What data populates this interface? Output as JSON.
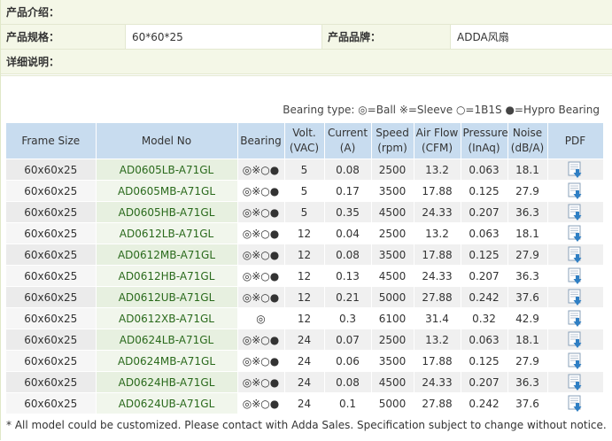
{
  "header": {
    "intro_label": "产品介绍：",
    "spec_label": "产品规格：",
    "spec_value": "60*60*25",
    "brand_label": "产品品牌：",
    "brand_value": "ADDA风扇",
    "detail_label": "详细说明："
  },
  "legend": {
    "prefix": "Bearing type:",
    "ball": "◎=Ball",
    "sleeve": "※=Sleeve",
    "b1s": "○=1B1S",
    "hypro": "●=Hypro Bearing"
  },
  "table": {
    "headers": [
      "Frame Size",
      "Model No",
      "Bearing",
      "Volt.\n(VAC)",
      "Current\n(A)",
      "Speed\n(rpm)",
      "Air Flow\n(CFM)",
      "Pressure\n(InAq)",
      "Noise\n(dB/A)",
      "PDF"
    ],
    "rows": [
      {
        "frame": "60x60x25",
        "model": "AD0605LB-A71GL",
        "bearing": "◎※○●",
        "volt": "5",
        "current": "0.08",
        "speed": "2500",
        "airflow": "13.2",
        "pressure": "0.063",
        "noise": "18.1"
      },
      {
        "frame": "60x60x25",
        "model": "AD0605MB-A71GL",
        "bearing": "◎※○●",
        "volt": "5",
        "current": "0.17",
        "speed": "3500",
        "airflow": "17.88",
        "pressure": "0.125",
        "noise": "27.9"
      },
      {
        "frame": "60x60x25",
        "model": "AD0605HB-A71GL",
        "bearing": "◎※○●",
        "volt": "5",
        "current": "0.35",
        "speed": "4500",
        "airflow": "24.33",
        "pressure": "0.207",
        "noise": "36.3"
      },
      {
        "frame": "60x60x25",
        "model": "AD0612LB-A71GL",
        "bearing": "◎※○●",
        "volt": "12",
        "current": "0.04",
        "speed": "2500",
        "airflow": "13.2",
        "pressure": "0.063",
        "noise": "18.1"
      },
      {
        "frame": "60x60x25",
        "model": "AD0612MB-A71GL",
        "bearing": "◎※○●",
        "volt": "12",
        "current": "0.08",
        "speed": "3500",
        "airflow": "17.88",
        "pressure": "0.125",
        "noise": "27.9"
      },
      {
        "frame": "60x60x25",
        "model": "AD0612HB-A71GL",
        "bearing": "◎※○●",
        "volt": "12",
        "current": "0.13",
        "speed": "4500",
        "airflow": "24.33",
        "pressure": "0.207",
        "noise": "36.3"
      },
      {
        "frame": "60x60x25",
        "model": "AD0612UB-A71GL",
        "bearing": "◎※○●",
        "volt": "12",
        "current": "0.21",
        "speed": "5000",
        "airflow": "27.88",
        "pressure": "0.242",
        "noise": "37.6"
      },
      {
        "frame": "60x60x25",
        "model": "AD0612XB-A71GL",
        "bearing": "◎",
        "volt": "12",
        "current": "0.3",
        "speed": "6100",
        "airflow": "31.4",
        "pressure": "0.32",
        "noise": "42.9"
      },
      {
        "frame": "60x60x25",
        "model": "AD0624LB-A71GL",
        "bearing": "◎※○●",
        "volt": "24",
        "current": "0.07",
        "speed": "2500",
        "airflow": "13.2",
        "pressure": "0.063",
        "noise": "18.1"
      },
      {
        "frame": "60x60x25",
        "model": "AD0624MB-A71GL",
        "bearing": "◎※○●",
        "volt": "24",
        "current": "0.06",
        "speed": "3500",
        "airflow": "17.88",
        "pressure": "0.125",
        "noise": "27.9"
      },
      {
        "frame": "60x60x25",
        "model": "AD0624HB-A71GL",
        "bearing": "◎※○●",
        "volt": "24",
        "current": "0.08",
        "speed": "4500",
        "airflow": "24.33",
        "pressure": "0.207",
        "noise": "36.3"
      },
      {
        "frame": "60x60x25",
        "model": "AD0624UB-A71GL",
        "bearing": "◎※○●",
        "volt": "24",
        "current": "0.1",
        "speed": "5000",
        "airflow": "27.88",
        "pressure": "0.242",
        "noise": "37.6"
      }
    ]
  },
  "footer": "* All model could be customized. Please contact with Adda Sales. Specification subject to change without notice.",
  "colors": {
    "header_bg": "#c8dcef",
    "model_text": "#2a6a1c",
    "pdf_icon": "#2f7fc4"
  },
  "icons": {
    "pdf": "pdf-download-icon"
  }
}
